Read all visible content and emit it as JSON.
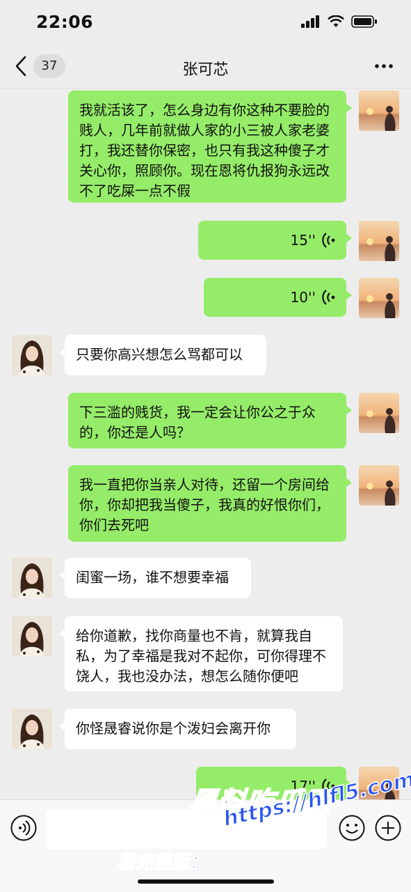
{
  "status_bar": {
    "time": "22:06"
  },
  "header": {
    "unread_count": "37",
    "title": "张可芯"
  },
  "messages": [
    {
      "side": "sent",
      "type": "text",
      "text": "我就活该了，怎么身边有你这种不要脸的贱人，几年前就做人家的小三被人家老婆打，我还替你保密，也只有我这种傻子才关心你，照顾你。现在恩将仇报狗永远改不了吃屎一点不假"
    },
    {
      "side": "sent",
      "type": "voice",
      "duration": "15''"
    },
    {
      "side": "sent",
      "type": "voice",
      "duration": "10''"
    },
    {
      "side": "received",
      "type": "text",
      "text": "只要你高兴想怎么骂都可以"
    },
    {
      "side": "sent",
      "type": "text",
      "text": "下三滥的贱货，我一定会让你公之于众的，你还是人吗？"
    },
    {
      "side": "sent",
      "type": "text",
      "text": "我一直把你当亲人对待，还留一个房间给你，你却把我当傻子，我真的好恨你们，你们去死吧"
    },
    {
      "side": "received",
      "type": "text",
      "text": "闺蜜一场，谁不想要幸福"
    },
    {
      "side": "received",
      "type": "text",
      "text": "给你道歉，找你商量也不肯，就算我自私，为了幸福是我对不起你，可你得理不饶人，我也没办法，想怎么随你便吧"
    },
    {
      "side": "received",
      "type": "text",
      "text": "你怪晟睿说你是个泼妇会离开你"
    },
    {
      "side": "sent",
      "type": "voice",
      "duration": "17''"
    }
  ],
  "input": {
    "placeholder": ""
  },
  "watermark": {
    "title": "黑料吃瓜网",
    "url_label": "看完整版：",
    "url": "https://hlfl5.com"
  },
  "colors": {
    "sent_bubble": "#95ec69",
    "received_bubble": "#ffffff",
    "background": "#ededed"
  }
}
